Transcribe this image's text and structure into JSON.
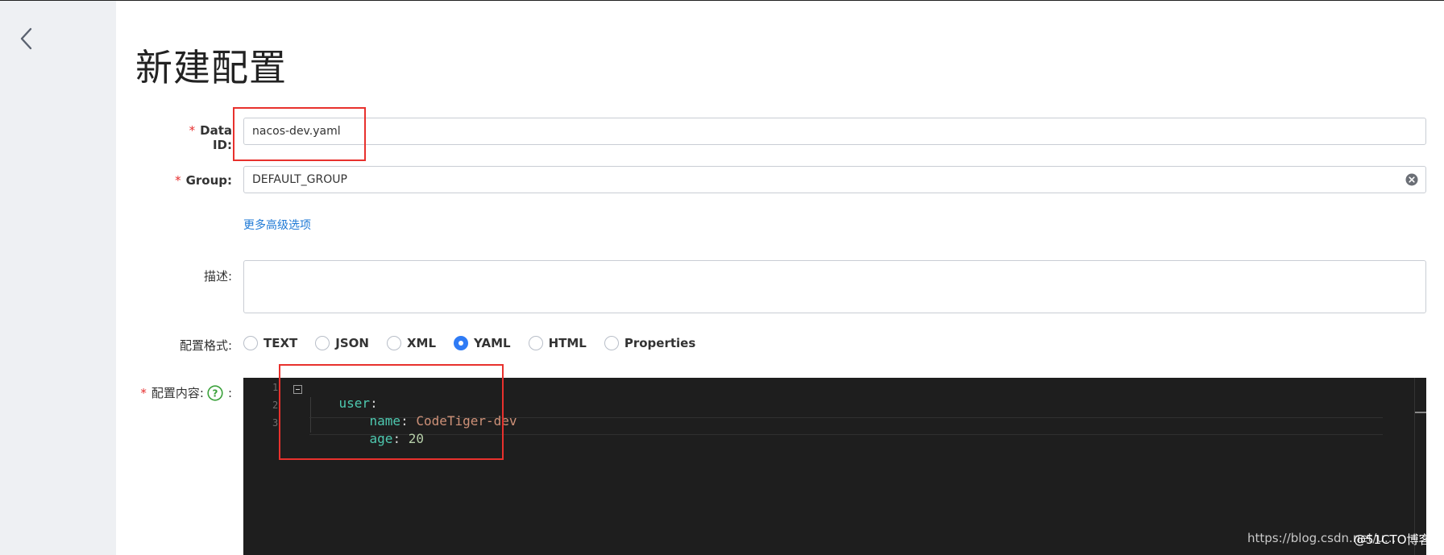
{
  "page": {
    "title": "新建配置"
  },
  "form": {
    "data_id": {
      "label": "Data ID:",
      "value": "nacos-dev.yaml"
    },
    "group": {
      "label": "Group:",
      "value": "DEFAULT_GROUP"
    },
    "advanced_link": "更多高级选项",
    "description": {
      "label": "描述:",
      "value": ""
    },
    "format": {
      "label": "配置格式:",
      "options": [
        "TEXT",
        "JSON",
        "XML",
        "YAML",
        "HTML",
        "Properties"
      ],
      "selected": "YAML"
    },
    "content": {
      "label": "配置内容:",
      "line_numbers": [
        "1",
        "2",
        "3"
      ],
      "lines": [
        {
          "key": "user",
          "sep": ":",
          "value": ""
        },
        {
          "key": "name",
          "sep": ": ",
          "value": "CodeTiger-dev"
        },
        {
          "key": "age",
          "sep": ": ",
          "value": "20"
        }
      ]
    }
  },
  "required_marker": "*",
  "watermark": "https://blog.csdn.net/u...",
  "watermark_overlay": "@51CTO博客",
  "icons": {
    "back": "chevron-left-icon",
    "clear": "clear-circle-icon",
    "help": "question-circle-icon",
    "fold": "fold-minus-icon"
  },
  "colors": {
    "accent": "#2f7bf5",
    "link": "#1f7ad6",
    "required": "#e62e2e",
    "highlight": "#e8312d",
    "editor_bg": "#1e1e1e"
  }
}
